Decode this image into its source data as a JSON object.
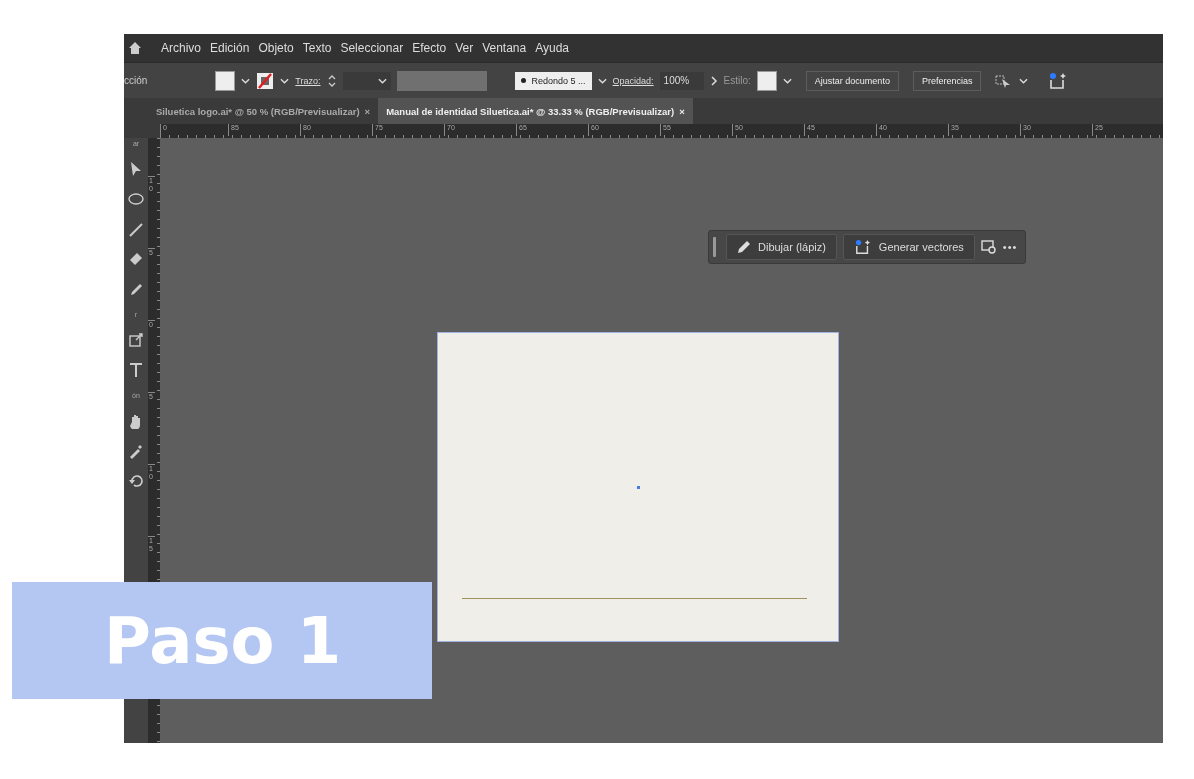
{
  "menu": [
    "Archivo",
    "Edición",
    "Objeto",
    "Texto",
    "Seleccionar",
    "Efecto",
    "Ver",
    "Ventana",
    "Ayuda"
  ],
  "control_bar": {
    "label": "cción",
    "stroke_label": "Trazo:",
    "brush": "Redondo 5 ...",
    "opacity_label": "Opacidad:",
    "opacity": "100%",
    "style_label": "Estilo:",
    "buttons": [
      "Ajustar documento",
      "Preferencias"
    ]
  },
  "tabs": [
    {
      "label": "Siluetica logo.ai* @ 50 % (RGB/Previsualizar)",
      "close": "×",
      "selected": false
    },
    {
      "label": "Manual de identidad Siluetica.ai* @ 33.33 % (RGB/Previsualizar)",
      "close": "×",
      "selected": true
    }
  ],
  "toolbar_labels": [
    "ar",
    "r",
    "ón"
  ],
  "ruler": {
    "horizontal": [
      "0",
      "85",
      "80",
      "75",
      "70",
      "65",
      "60",
      "55",
      "50",
      "45",
      "40",
      "35",
      "30",
      "25"
    ],
    "vertical": [
      "10",
      "5",
      "0",
      "5",
      "10",
      "15"
    ]
  },
  "context_bar": {
    "buttons": [
      "Dibujar (lápiz)",
      "Generar vectores"
    ],
    "more": "•••"
  },
  "overlay": {
    "title": "Paso 1"
  }
}
